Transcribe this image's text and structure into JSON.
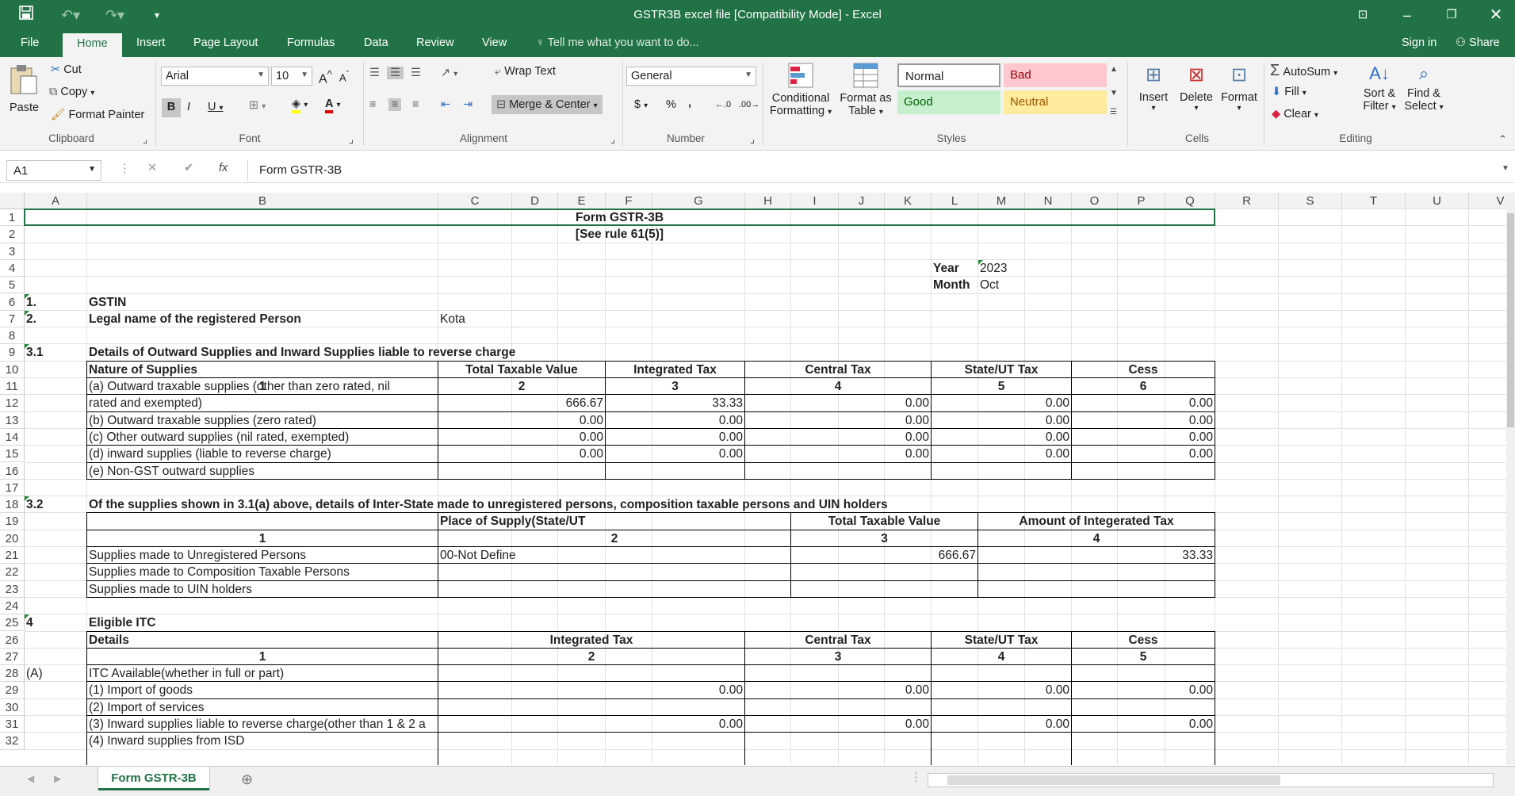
{
  "window": {
    "title": "GSTR3B excel file  [Compatibility Mode] - Excel"
  },
  "tabs": [
    "File",
    "Home",
    "Insert",
    "Page Layout",
    "Formulas",
    "Data",
    "Review",
    "View"
  ],
  "tell_me": "Tell me what you want to do...",
  "sign_in": "Sign in",
  "share": "Share",
  "ribbon": {
    "clipboard": {
      "paste": "Paste",
      "cut": "Cut",
      "copy": "Copy",
      "format_painter": "Format Painter",
      "label": "Clipboard"
    },
    "font": {
      "name": "Arial",
      "size": "10",
      "label": "Font"
    },
    "alignment": {
      "wrap": "Wrap Text",
      "merge": "Merge & Center",
      "label": "Alignment"
    },
    "number": {
      "format": "General",
      "label": "Number"
    },
    "styles": {
      "conditional": "Conditional",
      "formatting": "Formatting",
      "format_as": "Format as",
      "table": "Table",
      "normal": "Normal",
      "bad": "Bad",
      "good": "Good",
      "neutral": "Neutral",
      "label": "Styles"
    },
    "cells": {
      "insert": "Insert",
      "delete": "Delete",
      "format": "Format",
      "label": "Cells"
    },
    "editing": {
      "autosum": "AutoSum",
      "fill": "Fill",
      "clear": "Clear",
      "sort": "Sort &",
      "filter": "Filter",
      "find": "Find &",
      "select": "Select",
      "label": "Editing"
    }
  },
  "formula_bar": {
    "name_box": "A1",
    "content": "Form GSTR-3B"
  },
  "columns": [
    "A",
    "B",
    "C",
    "D",
    "E",
    "F",
    "G",
    "H",
    "I",
    "J",
    "K",
    "L",
    "M",
    "N",
    "O",
    "P",
    "Q",
    "R",
    "S",
    "T",
    "U",
    "V"
  ],
  "rows": [
    "1",
    "2",
    "3",
    "4",
    "5",
    "6",
    "7",
    "8",
    "9",
    "10",
    "11",
    "12",
    "13",
    "14",
    "15",
    "16",
    "17",
    "18",
    "19",
    "20",
    "21",
    "22",
    "23",
    "24",
    "25",
    "26",
    "27",
    "28",
    "29",
    "30",
    "31",
    "32"
  ],
  "sheet": {
    "title": "Form GSTR-3B",
    "subtitle": "[See rule 61(5)]",
    "year_label": "Year",
    "year": "2023",
    "month_label": "Month",
    "month": "Oct",
    "r6": {
      "num": "1.",
      "label": "GSTIN"
    },
    "r7": {
      "num": "2.",
      "label": "Legal name of the registered Person",
      "value": "Kota"
    },
    "s31": {
      "num": "3.1",
      "title": "Details of Outward Supplies and Inward Supplies liable to reverse charge",
      "headers": [
        "Nature of Supplies",
        "Total Taxable Value",
        "Integrated Tax",
        "Central Tax",
        "State/UT Tax",
        "Cess"
      ],
      "nums": [
        "1",
        "2",
        "3",
        "4",
        "5",
        "6"
      ],
      "rows": [
        {
          "label": "(a) Outward traxable supplies (other than zero rated, nil",
          "label2": "rated and exempted)",
          "vals": [
            "666.67",
            "33.33",
            "0.00",
            "0.00",
            "0.00"
          ]
        },
        {
          "label": "(b) Outward traxable supplies (zero rated)",
          "vals": [
            "0.00",
            "0.00",
            "0.00",
            "0.00",
            "0.00"
          ]
        },
        {
          "label": "(c) Other outward supplies (nil rated, exempted)",
          "vals": [
            "0.00",
            "0.00",
            "0.00",
            "0.00",
            "0.00"
          ]
        },
        {
          "label": "(d) inward supplies (liable to reverse charge)",
          "vals": [
            "0.00",
            "0.00",
            "0.00",
            "0.00",
            "0.00"
          ]
        },
        {
          "label": "(e) Non-GST outward supplies",
          "vals": [
            "",
            "",
            "",
            "",
            ""
          ]
        }
      ]
    },
    "s32": {
      "num": "3.2",
      "title": "Of the supplies shown in 3.1(a) above, details of Inter-State made to unregistered persons, composition taxable persons and UIN holders",
      "headers": [
        "Place of Supply(State/UT",
        "Total Taxable Value",
        "Amount of Integerated Tax"
      ],
      "nums": [
        "1",
        "2",
        "3",
        "4"
      ],
      "rows": [
        {
          "label": "Supplies made to Unregistered Persons",
          "place": "00-Not Define",
          "value": "666.67",
          "tax": "33.33"
        },
        {
          "label": "Supplies made to Composition Taxable Persons",
          "place": "",
          "value": "",
          "tax": ""
        },
        {
          "label": "Supplies made to UIN holders",
          "place": "",
          "value": "",
          "tax": ""
        }
      ]
    },
    "s4": {
      "num": "4",
      "title": "Eligible ITC",
      "headers": [
        "Details",
        "Integrated Tax",
        "Central Tax",
        "State/UT Tax",
        "Cess"
      ],
      "nums": [
        "1",
        "2",
        "3",
        "4",
        "5"
      ],
      "a_label": "(A)",
      "rows": [
        {
          "label": "ITC Available(whether in full or part)",
          "vals": [
            "",
            "",
            "",
            ""
          ]
        },
        {
          "label": "(1) Import of goods",
          "vals": [
            "0.00",
            "0.00",
            "0.00",
            "0.00"
          ]
        },
        {
          "label": "(2) Import of services",
          "vals": [
            "",
            "",
            "",
            ""
          ]
        },
        {
          "label": "(3) Inward supplies liable to reverse charge(other than 1 & 2 a",
          "vals": [
            "0.00",
            "0.00",
            "0.00",
            "0.00"
          ]
        },
        {
          "label": "(4) Inward supplies from ISD",
          "vals": [
            "",
            "",
            "",
            ""
          ]
        }
      ]
    }
  },
  "sheet_tab": "Form GSTR-3B"
}
